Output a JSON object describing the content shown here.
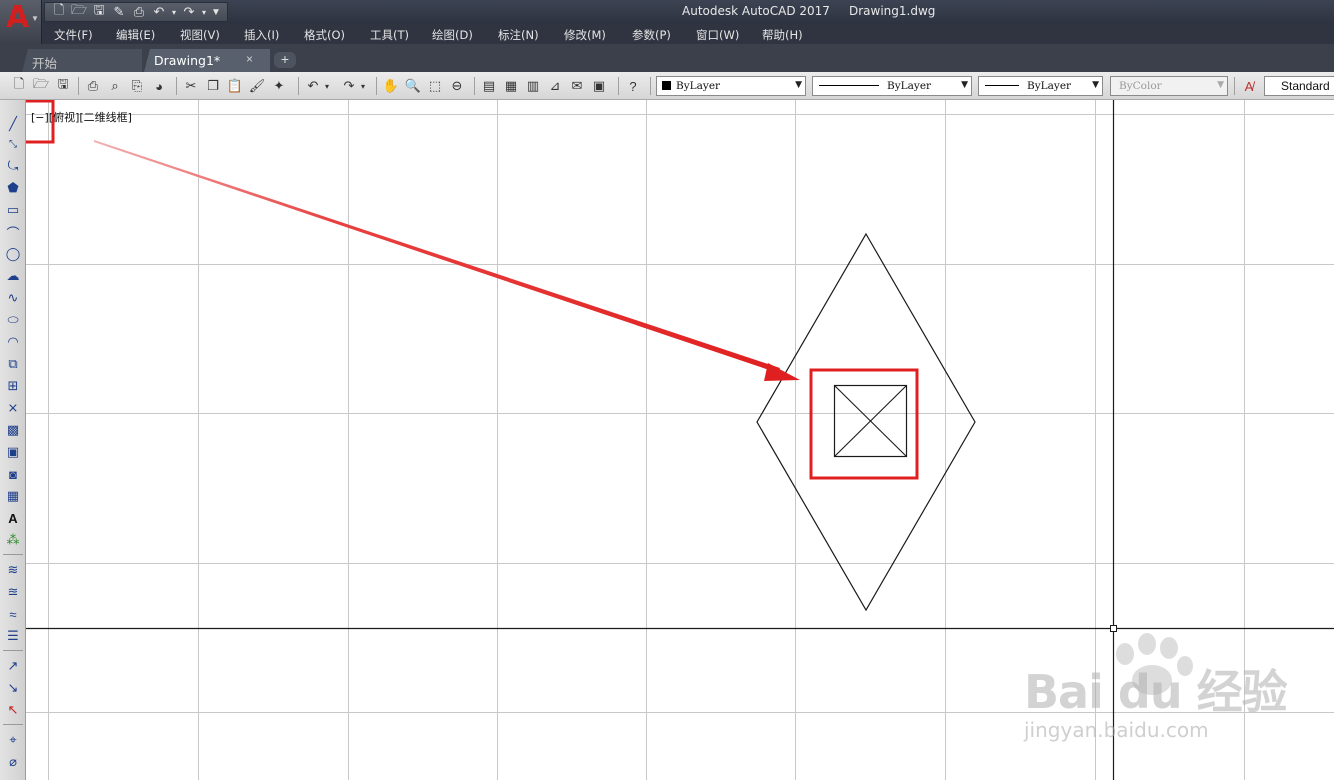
{
  "window": {
    "app_name": "Autodesk AutoCAD 2017",
    "file_name": "Drawing1.dwg",
    "app_logo_letter": "A"
  },
  "quick_access": {
    "icons": [
      "new-icon",
      "open-icon",
      "save-icon",
      "saveas-icon",
      "plot-icon",
      "undo-icon",
      "redo-icon",
      "customize-icon"
    ]
  },
  "menu": {
    "items": [
      "文件(F)",
      "编辑(E)",
      "视图(V)",
      "插入(I)",
      "格式(O)",
      "工具(T)",
      "绘图(D)",
      "标注(N)",
      "修改(M)",
      "参数(P)",
      "窗口(W)",
      "帮助(H)"
    ]
  },
  "tabs": {
    "start": "开始",
    "drawing": "Drawing1*",
    "close_glyph": "×",
    "add_glyph": "+"
  },
  "properties": {
    "color": "ByLayer",
    "linetype": "ByLayer",
    "lineweight": "ByLayer",
    "plotstyle": "ByColor",
    "text_style": "Standard"
  },
  "viewport": {
    "label": "[−][俯视][二维线框]"
  },
  "watermark": {
    "brand": "Bai du 经验",
    "url": "jingyan.baidu.com"
  },
  "colors": {
    "highlight": "#e02020",
    "arrow": "#e02020",
    "grid": "#c8c8c8",
    "axis": "#1a1a1a",
    "drawing": "#1a1a1a"
  }
}
